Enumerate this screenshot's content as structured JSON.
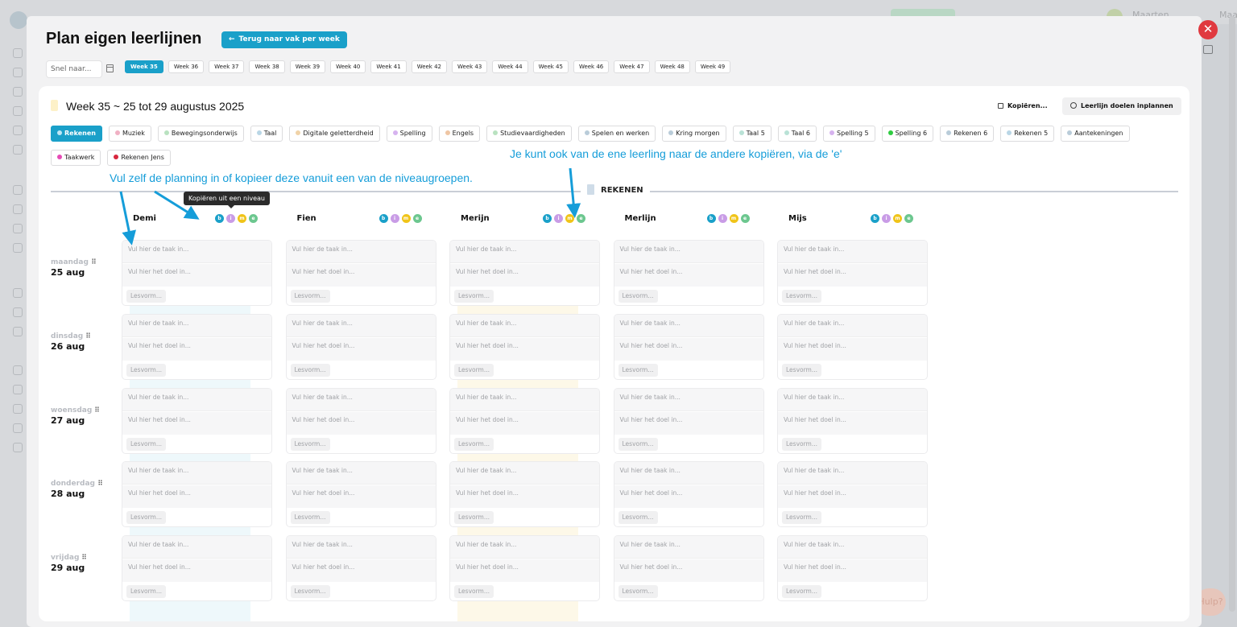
{
  "background": {
    "user_name": "Maarten",
    "user_name_right": "Maarten",
    "help_text": "Hulp?"
  },
  "header": {
    "title": "Plan eigen leerlijnen",
    "back_button": "Terug naar vak per week",
    "quick_search_placeholder": "Snel naar..."
  },
  "weeks": [
    "Week 35",
    "Week 36",
    "Week 37",
    "Week 38",
    "Week 39",
    "Week 40",
    "Week 41",
    "Week 42",
    "Week 43",
    "Week 44",
    "Week 45",
    "Week 46",
    "Week 47",
    "Week 48",
    "Week 49"
  ],
  "active_week_index": 0,
  "panel": {
    "week_title": "Week 35 ~ 25 tot 29 augustus 2025",
    "copy_button": "Kopiëren...",
    "plan_button": "Leerlijn doelen inplannen",
    "group_label": "REKENEN"
  },
  "subjects": [
    {
      "label": "Rekenen",
      "color": "#9fd4ea",
      "active": true
    },
    {
      "label": "Muziek",
      "color": "#f0b1c4"
    },
    {
      "label": "Bewegingsonderwijs",
      "color": "#b9e2c0"
    },
    {
      "label": "Taal",
      "color": "#b9d6e6"
    },
    {
      "label": "Digitale geletterdheid",
      "color": "#f0d3a8"
    },
    {
      "label": "Spelling",
      "color": "#d6b3ef"
    },
    {
      "label": "Engels",
      "color": "#efc6a4"
    },
    {
      "label": "Studievaardigheden",
      "color": "#b9e2c0"
    },
    {
      "label": "Spelen en werken",
      "color": "#b9ccd9"
    },
    {
      "label": "Kring morgen",
      "color": "#b9ccd9"
    },
    {
      "label": "Taal 5",
      "color": "#b9e2d6"
    },
    {
      "label": "Taal 6",
      "color": "#b9e2d6"
    },
    {
      "label": "Spelling 5",
      "color": "#d6b3ef"
    },
    {
      "label": "Spelling 6",
      "color": "#2ecc40"
    },
    {
      "label": "Rekenen 6",
      "color": "#b9ccd9"
    },
    {
      "label": "Rekenen 5",
      "color": "#b9d6e6"
    },
    {
      "label": "Aantekeningen",
      "color": "#b9ccd9"
    },
    {
      "label": "Taakwerk",
      "color": "#e64bb6"
    },
    {
      "label": "Rekenen Jens",
      "color": "#d7263d"
    }
  ],
  "levels": [
    {
      "letter": "b",
      "color": "#1aa0c9"
    },
    {
      "letter": "i",
      "color": "#c99ce6"
    },
    {
      "letter": "m",
      "color": "#f0c419"
    },
    {
      "letter": "e",
      "color": "#6cc78f"
    }
  ],
  "students": [
    "Demi",
    "Fien",
    "Merijn",
    "Merlijn",
    "Mijs"
  ],
  "days": [
    {
      "name": "maandag",
      "date": "25 aug"
    },
    {
      "name": "dinsdag",
      "date": "26 aug"
    },
    {
      "name": "woensdag",
      "date": "27 aug"
    },
    {
      "name": "donderdag",
      "date": "28 aug"
    },
    {
      "name": "vrijdag",
      "date": "29 aug"
    }
  ],
  "cell": {
    "task_placeholder": "Vul hier de taak in...",
    "goal_placeholder": "Vul hier het doel in...",
    "lesvorm_placeholder": "Lesvorm..."
  },
  "annotations": {
    "left_note": "Vul zelf de planning in of kopieer deze vanuit een van de niveaugroepen.",
    "right_note": "Je kunt ook van de ene leerling naar de andere kopiëren, via de 'e'",
    "tooltip": "Kopiëren uit een niveau"
  },
  "colors": {
    "accent": "#1aa0c9",
    "close": "#e0393f",
    "annotation": "#159dd9"
  }
}
